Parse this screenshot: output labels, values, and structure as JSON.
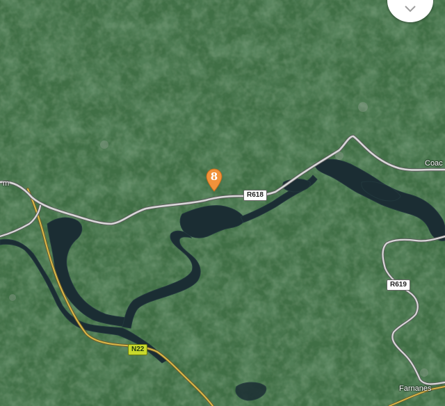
{
  "map": {
    "roads": [
      {
        "label": "R618",
        "type": "regional"
      },
      {
        "label": "R619",
        "type": "regional"
      },
      {
        "label": "N22",
        "type": "national"
      }
    ],
    "places": [
      {
        "label": "Coac"
      },
      {
        "label": "Farnanes"
      },
      {
        "label": "m"
      }
    ],
    "marker": {
      "label": "8",
      "color": "#f0923a"
    },
    "compass": {
      "icon": "chevron-down-icon"
    },
    "colors": {
      "land": "#3d6b43",
      "water": "#1b2d33",
      "road_regional": "#d8d8d8",
      "road_national": "#d9b94a"
    }
  }
}
